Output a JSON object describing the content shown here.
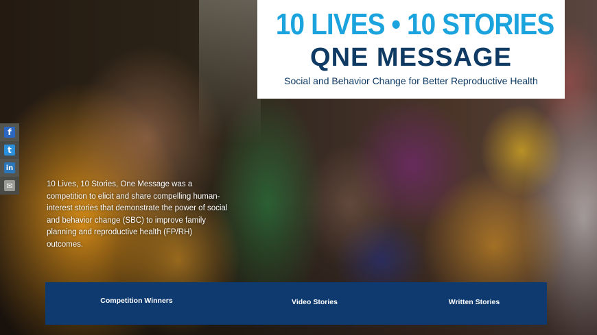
{
  "header": {
    "title_line1": "10 LIVES • 10 STORIES",
    "title_line2": "QNE MESSAGE",
    "subtitle": "Social and Behavior Change for Better Reproductive Health"
  },
  "share": {
    "items": [
      {
        "name": "facebook",
        "icon": "facebook-icon",
        "glyph": "f"
      },
      {
        "name": "twitter",
        "icon": "twitter-icon",
        "glyph": "t"
      },
      {
        "name": "linkedin",
        "icon": "linkedin-icon",
        "glyph": "in"
      },
      {
        "name": "email",
        "icon": "email-icon",
        "glyph": "✉"
      }
    ]
  },
  "intro": {
    "text": "10 Lives, 10 Stories, One Message was a competition to elicit and share compelling human-interest stories that demonstrate the power of social and behavior change (SBC) to improve family planning and reproductive health (FP/RH) outcomes."
  },
  "nav": {
    "items": [
      {
        "label": "Competition Winners"
      },
      {
        "label": "Video Stories"
      },
      {
        "label": "Written Stories"
      }
    ]
  },
  "colors": {
    "accent_blue": "#1aa3dc",
    "navy": "#0e3a63",
    "nav_bar": "#0e3a70"
  }
}
